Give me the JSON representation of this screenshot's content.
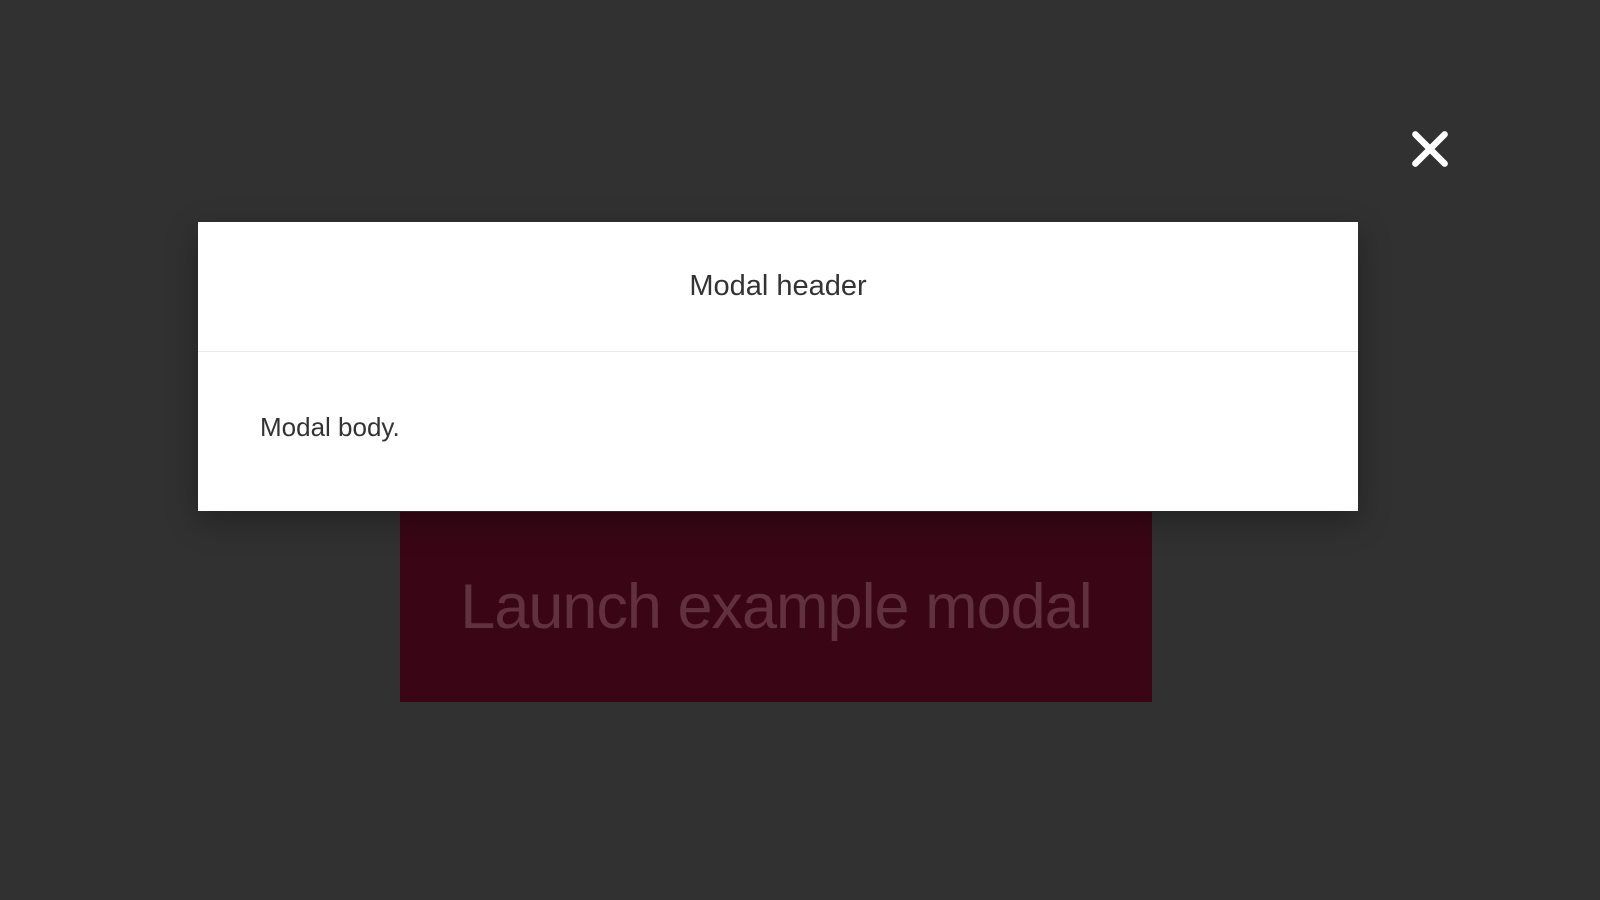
{
  "launch_button_label": "Launch example modal",
  "modal": {
    "header_title": "Modal header",
    "body_text": "Modal body."
  }
}
